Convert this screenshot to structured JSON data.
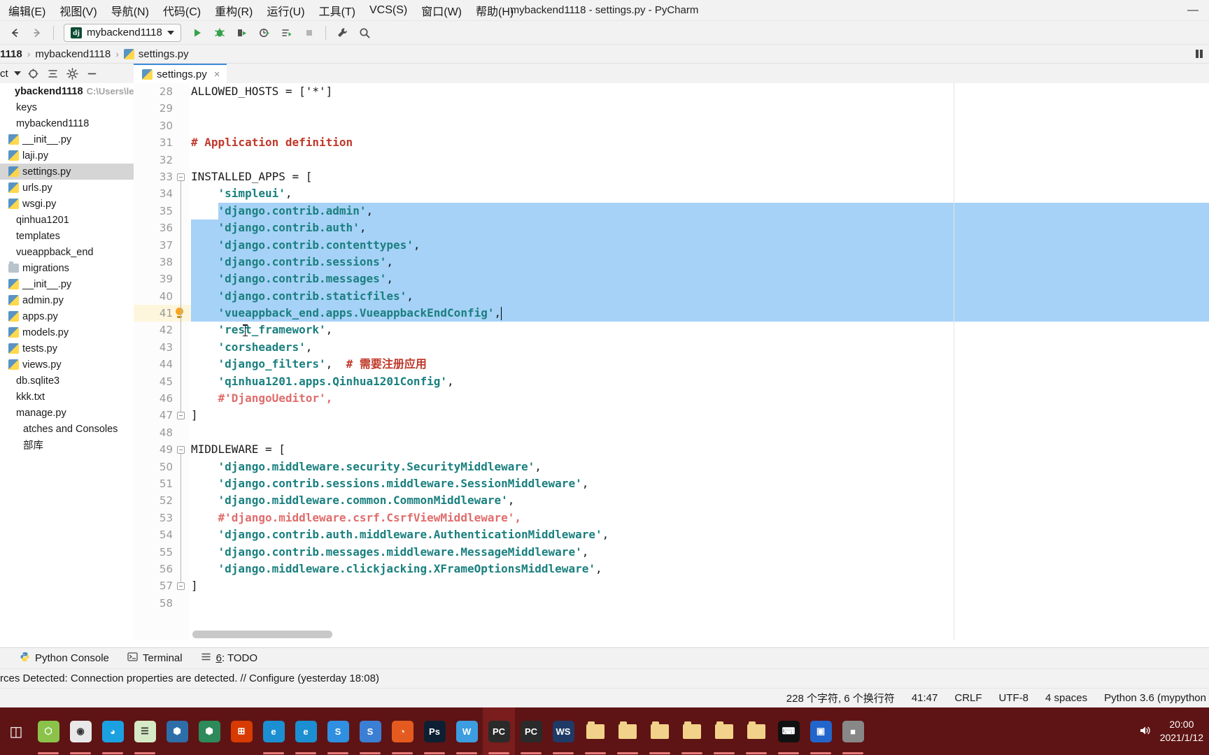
{
  "window": {
    "title": "mybackend1118 - settings.py - PyCharm",
    "minimize": "—"
  },
  "menubar": {
    "items": [
      {
        "label": "编辑(E)",
        "name": "menu-edit"
      },
      {
        "label": "视图(V)",
        "name": "menu-view"
      },
      {
        "label": "导航(N)",
        "name": "menu-navigate"
      },
      {
        "label": "代码(C)",
        "name": "menu-code"
      },
      {
        "label": "重构(R)",
        "name": "menu-refactor"
      },
      {
        "label": "运行(U)",
        "name": "menu-run"
      },
      {
        "label": "工具(T)",
        "name": "menu-tools"
      },
      {
        "label": "VCS(S)",
        "name": "menu-vcs"
      },
      {
        "label": "窗口(W)",
        "name": "menu-window"
      },
      {
        "label": "帮助(H)",
        "name": "menu-help"
      }
    ]
  },
  "toolbar": {
    "back": "←",
    "forward": "→",
    "run_config": "mybackend1118",
    "dj_badge": "dj",
    "run": "▶",
    "debug": "debug-icon",
    "run_coverage": "run-with-coverage-icon",
    "profile": "profile-icon",
    "run_tests": "run-tests-icon",
    "stop": "■",
    "settings": "wrench-icon",
    "search": "search-icon"
  },
  "breadcrumb": {
    "project": "1118",
    "package": "mybackend1118",
    "file": "settings.py",
    "separator": "›"
  },
  "project_panel": {
    "title": "ct",
    "icons": [
      "locate-icon",
      "collapse-all-icon",
      "gear-icon",
      "hide-icon"
    ],
    "tree": [
      {
        "label": "ybackend1118",
        "hint": "C:\\Users\\lenovo",
        "kind": "root",
        "indent": 0,
        "selected": false
      },
      {
        "label": "keys",
        "hint": "",
        "kind": "folder-plain",
        "indent": 1,
        "selected": false
      },
      {
        "label": "mybackend1118",
        "hint": "",
        "kind": "folder-plain",
        "indent": 1,
        "selected": false
      },
      {
        "label": "__init__.py",
        "hint": "",
        "kind": "python",
        "indent": 2,
        "selected": false
      },
      {
        "label": "laji.py",
        "hint": "",
        "kind": "python",
        "indent": 2,
        "selected": false
      },
      {
        "label": "settings.py",
        "hint": "",
        "kind": "python",
        "indent": 2,
        "selected": true
      },
      {
        "label": "urls.py",
        "hint": "",
        "kind": "python",
        "indent": 2,
        "selected": false
      },
      {
        "label": "wsgi.py",
        "hint": "",
        "kind": "python",
        "indent": 2,
        "selected": false
      },
      {
        "label": "qinhua1201",
        "hint": "",
        "kind": "folder-plain",
        "indent": 1,
        "selected": false
      },
      {
        "label": "templates",
        "hint": "",
        "kind": "folder-plain",
        "indent": 1,
        "selected": false
      },
      {
        "label": "vueappback_end",
        "hint": "",
        "kind": "folder-plain",
        "indent": 1,
        "selected": false
      },
      {
        "label": "migrations",
        "hint": "",
        "kind": "folder",
        "indent": 2,
        "selected": false
      },
      {
        "label": "__init__.py",
        "hint": "",
        "kind": "python",
        "indent": 2,
        "selected": false
      },
      {
        "label": "admin.py",
        "hint": "",
        "kind": "python",
        "indent": 2,
        "selected": false
      },
      {
        "label": "apps.py",
        "hint": "",
        "kind": "python",
        "indent": 2,
        "selected": false
      },
      {
        "label": "models.py",
        "hint": "",
        "kind": "python",
        "indent": 2,
        "selected": false
      },
      {
        "label": "tests.py",
        "hint": "",
        "kind": "python",
        "indent": 2,
        "selected": false
      },
      {
        "label": "views.py",
        "hint": "",
        "kind": "python",
        "indent": 2,
        "selected": false
      },
      {
        "label": "db.sqlite3",
        "hint": "",
        "kind": "plain",
        "indent": 1,
        "selected": false
      },
      {
        "label": "kkk.txt",
        "hint": "",
        "kind": "plain",
        "indent": 1,
        "selected": false
      },
      {
        "label": "manage.py",
        "hint": "",
        "kind": "plain",
        "indent": 1,
        "selected": false
      },
      {
        "label": "atches and Consoles",
        "hint": "",
        "kind": "plain",
        "indent": 0,
        "selected": false
      },
      {
        "label": "部库",
        "hint": "",
        "kind": "plain",
        "indent": 0,
        "selected": false
      }
    ]
  },
  "editor": {
    "tab": {
      "label": "settings.py",
      "close": "×"
    },
    "first_line_number": 28,
    "lines": [
      {
        "n": 28,
        "text": "ALLOWED_HOSTS = ['*']",
        "kind": "code",
        "sel": false
      },
      {
        "n": 29,
        "text": "",
        "kind": "code",
        "sel": false
      },
      {
        "n": 30,
        "text": "",
        "kind": "code",
        "sel": false
      },
      {
        "n": 31,
        "text": "# Application definition",
        "kind": "comment",
        "sel": false
      },
      {
        "n": 32,
        "text": "",
        "kind": "code",
        "sel": false
      },
      {
        "n": 33,
        "text": "INSTALLED_APPS = [",
        "kind": "code",
        "sel": false,
        "fold": true
      },
      {
        "n": 34,
        "text": "    'simpleui',",
        "kind": "string-item",
        "sel": false
      },
      {
        "n": 35,
        "text": "    'django.contrib.admin',",
        "kind": "string-item",
        "sel": true
      },
      {
        "n": 36,
        "text": "    'django.contrib.auth',",
        "kind": "string-item",
        "sel": true
      },
      {
        "n": 37,
        "text": "    'django.contrib.contenttypes',",
        "kind": "string-item",
        "sel": true
      },
      {
        "n": 38,
        "text": "    'django.contrib.sessions',",
        "kind": "string-item",
        "sel": true
      },
      {
        "n": 39,
        "text": "    'django.contrib.messages',",
        "kind": "string-item",
        "sel": true
      },
      {
        "n": 40,
        "text": "    'django.contrib.staticfiles',",
        "kind": "string-item",
        "sel": true
      },
      {
        "n": 41,
        "text": "    'vueappback_end.apps.VueappbackEndConfig',",
        "kind": "string-item",
        "sel": true,
        "bulb": true,
        "caret": true,
        "current": true
      },
      {
        "n": 42,
        "text": "    'rest_framework',",
        "kind": "string-item",
        "sel": false,
        "mouse": true
      },
      {
        "n": 43,
        "text": "    'corsheaders',",
        "kind": "string-item",
        "sel": false
      },
      {
        "n": 44,
        "text": "    'django_filters',  # 需要注册应用",
        "kind": "string-comment",
        "sel": false
      },
      {
        "n": 45,
        "text": "    'qinhua1201.apps.Qinhua1201Config',",
        "kind": "string-item",
        "sel": false
      },
      {
        "n": 46,
        "text": "    #'DjangoUeditor',",
        "kind": "comment-str",
        "sel": false
      },
      {
        "n": 47,
        "text": "]",
        "kind": "code",
        "sel": false,
        "foldend": true
      },
      {
        "n": 48,
        "text": "",
        "kind": "code",
        "sel": false
      },
      {
        "n": 49,
        "text": "MIDDLEWARE = [",
        "kind": "code",
        "sel": false,
        "fold": true
      },
      {
        "n": 50,
        "text": "    'django.middleware.security.SecurityMiddleware',",
        "kind": "string-item",
        "sel": false
      },
      {
        "n": 51,
        "text": "    'django.contrib.sessions.middleware.SessionMiddleware',",
        "kind": "string-item",
        "sel": false
      },
      {
        "n": 52,
        "text": "    'django.middleware.common.CommonMiddleware',",
        "kind": "string-item",
        "sel": false
      },
      {
        "n": 53,
        "text": "    #'django.middleware.csrf.CsrfViewMiddleware',",
        "kind": "comment-str",
        "sel": false
      },
      {
        "n": 54,
        "text": "    'django.contrib.auth.middleware.AuthenticationMiddleware',",
        "kind": "string-item",
        "sel": false
      },
      {
        "n": 55,
        "text": "    'django.contrib.messages.middleware.MessageMiddleware',",
        "kind": "string-item",
        "sel": false
      },
      {
        "n": 56,
        "text": "    'django.middleware.clickjacking.XFrameOptionsMiddleware',",
        "kind": "string-item",
        "sel": false
      },
      {
        "n": 57,
        "text": "]",
        "kind": "code",
        "sel": false,
        "foldend": true
      },
      {
        "n": 58,
        "text": "",
        "kind": "code",
        "sel": false
      }
    ]
  },
  "tool_windows": {
    "items": [
      {
        "label": "Python Console",
        "icon": "python-console-icon",
        "num": ""
      },
      {
        "label": "Terminal",
        "icon": "terminal-icon",
        "num": ""
      },
      {
        "label": "6: TODO",
        "icon": "todo-icon",
        "num": "6"
      }
    ]
  },
  "notification": {
    "text": "rces Detected: Connection properties are detected. // Configure (yesterday 18:08)"
  },
  "statusbar": {
    "chars": "228 个字符, 6 个换行符",
    "caret": "41:47",
    "line_sep": "CRLF",
    "encoding": "UTF-8",
    "indent": "4 spaces",
    "interpreter": "Python 3.6 (mypython"
  },
  "taskbar": {
    "start": "task-view-icon",
    "apps": [
      {
        "name": "taskbar-icon-ethereum",
        "glyph": "⬡",
        "bg": "#8bc34a",
        "running": true
      },
      {
        "name": "taskbar-icon-chrome",
        "glyph": "◉",
        "bg": "#e8e8e8",
        "running": true
      },
      {
        "name": "taskbar-icon-quark",
        "glyph": "◕",
        "bg": "#1ba1e2",
        "running": true
      },
      {
        "name": "taskbar-icon-notepad",
        "glyph": "☰",
        "bg": "#d6e9c6",
        "running": true
      },
      {
        "name": "taskbar-icon-vscode",
        "glyph": "⬢",
        "bg": "#2d6ea8",
        "running": false
      },
      {
        "name": "taskbar-icon-vscode-insiders",
        "glyph": "⬢",
        "bg": "#2d8a5a",
        "running": false
      },
      {
        "name": "taskbar-icon-office",
        "glyph": "⊞",
        "bg": "#d83b01",
        "running": false
      },
      {
        "name": "taskbar-icon-edge-legacy",
        "glyph": "e",
        "bg": "#1b8fd1",
        "running": true
      },
      {
        "name": "taskbar-icon-edge",
        "glyph": "e",
        "bg": "#1b8fd1",
        "running": true
      },
      {
        "name": "taskbar-icon-sougou",
        "glyph": "S",
        "bg": "#2f8fe0",
        "running": true
      },
      {
        "name": "taskbar-icon-shanchuan",
        "glyph": "S",
        "bg": "#3b7fd4",
        "running": true
      },
      {
        "name": "taskbar-icon-firefox",
        "glyph": "◔",
        "bg": "#e55b1f",
        "running": true
      },
      {
        "name": "taskbar-icon-photoshop",
        "glyph": "Ps",
        "bg": "#0d2033",
        "running": true
      },
      {
        "name": "taskbar-icon-wps",
        "glyph": "W",
        "bg": "#3c9de0",
        "running": true
      },
      {
        "name": "taskbar-icon-pycharm-active",
        "glyph": "PC",
        "bg": "#2a2a2a",
        "running": true,
        "active": true
      },
      {
        "name": "taskbar-icon-pycharm",
        "glyph": "PC",
        "bg": "#2a2a2a",
        "running": true
      },
      {
        "name": "taskbar-icon-webstorm",
        "glyph": "WS",
        "bg": "#1f3a66",
        "running": true
      },
      {
        "name": "taskbar-icon-folder-1",
        "glyph": "",
        "bg": "folder",
        "running": true
      },
      {
        "name": "taskbar-icon-folder-2",
        "glyph": "",
        "bg": "folder",
        "running": true
      },
      {
        "name": "taskbar-icon-folder-3",
        "glyph": "",
        "bg": "folder",
        "running": true
      },
      {
        "name": "taskbar-icon-folder-4",
        "glyph": "",
        "bg": "folder",
        "running": true
      },
      {
        "name": "taskbar-icon-folder-5",
        "glyph": "",
        "bg": "folder",
        "running": true
      },
      {
        "name": "taskbar-icon-folder-6",
        "glyph": "",
        "bg": "folder",
        "running": true
      },
      {
        "name": "taskbar-icon-cmd",
        "glyph": "⌨",
        "bg": "#111111",
        "running": true
      },
      {
        "name": "taskbar-icon-tool-a",
        "glyph": "▣",
        "bg": "#2266cc",
        "running": true
      },
      {
        "name": "taskbar-icon-tool-b",
        "glyph": "■",
        "bg": "#888888",
        "running": true
      }
    ],
    "sound_icon": "volume-icon",
    "time": "20:00",
    "date": "2021/1/12"
  },
  "colors": {
    "accent": "#3b8cd9",
    "selection": "#a6d2f7",
    "string": "#1a7f7f",
    "comment": "#c0392b",
    "taskbar": "#5e1414"
  }
}
